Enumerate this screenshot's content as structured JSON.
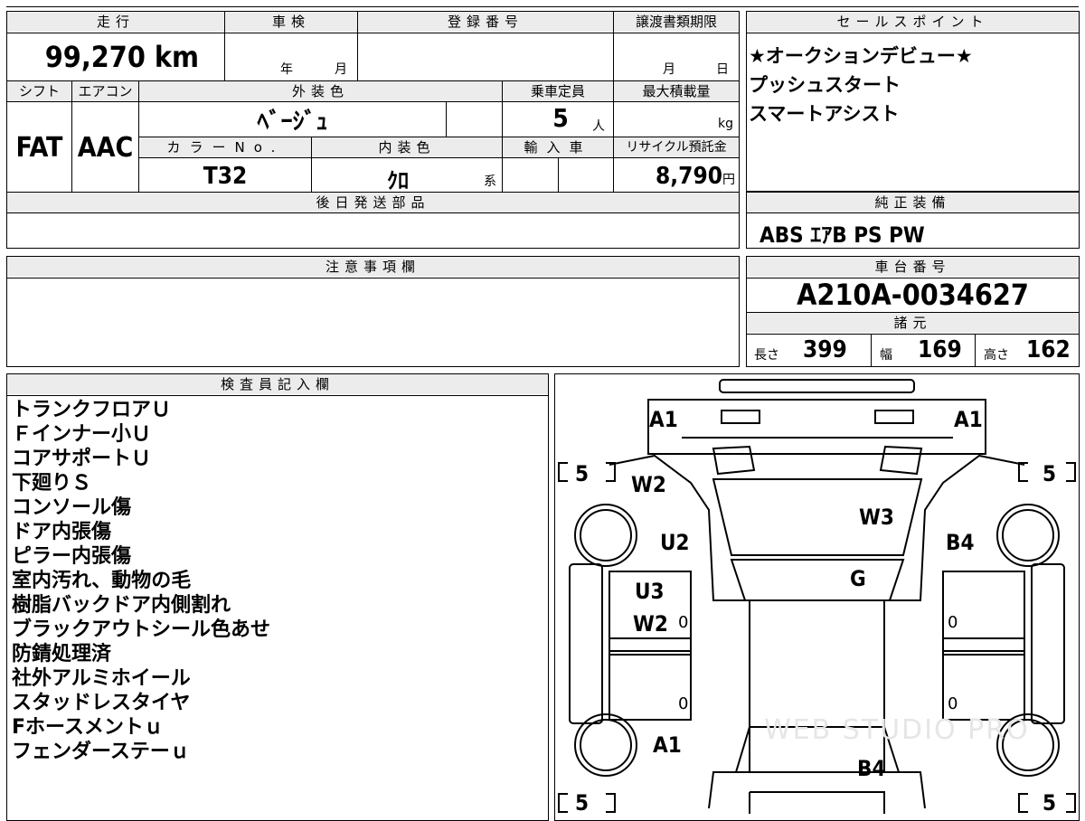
{
  "vehicle_info": {
    "headers": {
      "mileage": "走行",
      "inspection": "車検",
      "registration": "登録番号",
      "transfer_deadline": "譲渡書類期限",
      "shift": "シフト",
      "aircon": "エアコン",
      "exterior_color": "外装色",
      "capacity": "乗車定員",
      "max_load": "最大積載量",
      "color_no": "カラーNo.",
      "interior_color": "内装色",
      "import": "輸入車",
      "recycle_fee": "リサイクル預託金",
      "deferred_parts": "後日発送部品"
    },
    "mileage": "99,270",
    "mileage_unit": "km",
    "inspection_year_label": "年",
    "inspection_month_label": "月",
    "transfer_month_label": "月",
    "transfer_day_label": "日",
    "shift": "FAT",
    "aircon": "AAC",
    "exterior_color": "ﾍﾞｰｼﾞｭ",
    "capacity": "5",
    "capacity_unit": "人",
    "max_load_unit": "kg",
    "color_no": "T32",
    "interior_color": "ｸﾛ",
    "interior_suffix": "系",
    "recycle_fee": "8,790",
    "recycle_unit": "円"
  },
  "sales_points": {
    "header": "セールスポイント",
    "lines": [
      "★オークションデビュー★",
      "プッシュスタート",
      "スマートアシスト"
    ]
  },
  "standard_equipment": {
    "header": "純正装備",
    "value": "ABS ｴｱB PS PW"
  },
  "notes": {
    "header": "注意事項欄"
  },
  "chassis": {
    "header": "車台番号",
    "value": "A210A-0034627",
    "specs_header": "諸元",
    "length_label": "長さ",
    "length": "399",
    "width_label": "幅",
    "width": "169",
    "height_label": "高さ",
    "height": "162"
  },
  "inspector": {
    "header": "検査員記入欄",
    "lines": [
      "トランクフロアＵ",
      "Ｆインナー小Ｕ",
      "コアサポートＵ",
      "下廻りＳ",
      "コンソール傷",
      "ドア内張傷",
      "ピラー内張傷",
      "室内汚れ、動物の毛",
      "樹脂バックドア内側割れ",
      "ブラックアウトシール色あせ",
      "防錆処理済",
      "社外アルミホイール",
      "スタッドレスタイヤ",
      "Fホースメントｕ",
      "フェンダーステーｕ"
    ]
  },
  "diagram": {
    "tire_depth": "5",
    "marks": {
      "front_left": "A1",
      "front_right": "A1",
      "hood_left": "W2",
      "windshield": "W3",
      "left_fender": "U2",
      "right_fender": "B4",
      "roof_center": "G",
      "left_door_front_1": "U3",
      "left_door_front_2": "W2",
      "rear_left": "A1",
      "rear_center": "B4"
    },
    "door_zero": "0",
    "watermark": "WEB STUDIO PRO"
  }
}
